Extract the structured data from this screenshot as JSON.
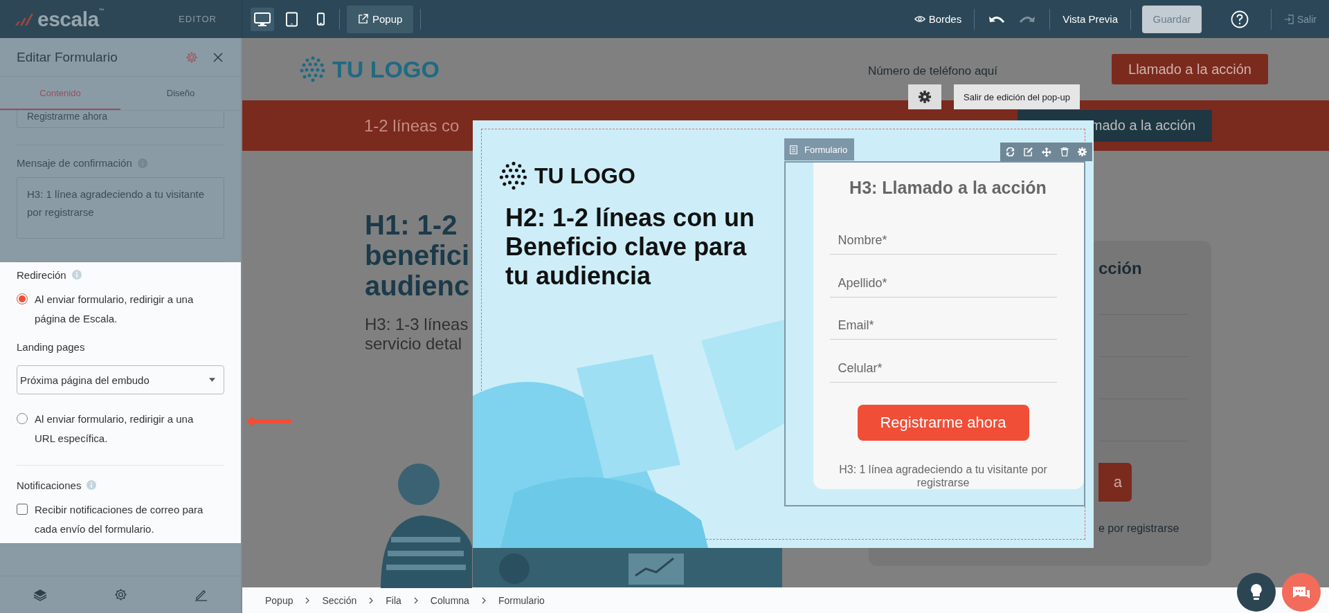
{
  "topbar": {
    "logo": "escala",
    "logo_mark": "™",
    "mode": "EDITOR",
    "devices": [
      {
        "kind": "desktop",
        "selected": true
      },
      {
        "kind": "tablet",
        "selected": false
      },
      {
        "kind": "mobile",
        "selected": false
      }
    ],
    "popup_button": "Popup",
    "borders": "Bordes",
    "undo": {
      "disabled": false
    },
    "redo": {
      "disabled": true
    },
    "preview": "Vista Previa",
    "save": {
      "label": "Guardar",
      "disabled": true
    },
    "exit": "Salir"
  },
  "panel": {
    "title": "Editar Formulario",
    "tabs": [
      {
        "label": "Contenido",
        "selected": true
      },
      {
        "label": "Diseño",
        "selected": false
      }
    ],
    "button_text": "Registrarme ahora",
    "confirmation": {
      "label": "Mensaje de confirmación",
      "value": "H3: 1 línea agradeciendo a tu visitante por registrarse"
    },
    "redirect": {
      "label": "Redireción",
      "options": [
        {
          "label": "Al enviar formulario, redirigir a una página de Escala.",
          "selected": true
        },
        {
          "label": "Al enviar formulario, redirigir a una URL específica.",
          "selected": false
        }
      ],
      "landing_label": "Landing pages",
      "landing_value": "Próxima página del embudo"
    },
    "notifications": {
      "label": "Notificaciones",
      "option": {
        "label": "Recibir notificaciones de correo para cada envío del formulario.",
        "checked": false
      }
    }
  },
  "page": {
    "logo": "TU LOGO",
    "phone": "Número de teléfono aquí",
    "cta": "Llamado a la acción",
    "band_text": "1-2 líneas co",
    "band_cta": "mado a la acción",
    "h1_lines": [
      "H1: 1-2",
      "benefici",
      "audienc"
    ],
    "h3_lines": [
      "H3: 1-3 líneas",
      "servicio detal"
    ],
    "card_title": "cción",
    "card_button": "a",
    "card_note": "e por registrarse"
  },
  "popup": {
    "settings_tooltip": "Salir de edición del pop-up",
    "logo": "TU LOGO",
    "headline": "H2: 1-2 líneas con un Beneficio clave para tu audiencia",
    "form": {
      "tag": "Formulario",
      "title": "H3: Llamado a la acción",
      "fields": [
        {
          "placeholder": "Nombre*"
        },
        {
          "placeholder": "Apellido*"
        },
        {
          "placeholder": "Email*"
        },
        {
          "placeholder": "Celular*"
        }
      ],
      "submit": "Registrarme ahora",
      "note": "H3: 1 línea agradeciendo a tu visitante por registrarse"
    }
  },
  "breadcrumb": [
    "Popup",
    "Sección",
    "Fila",
    "Columna",
    "Formulario"
  ]
}
